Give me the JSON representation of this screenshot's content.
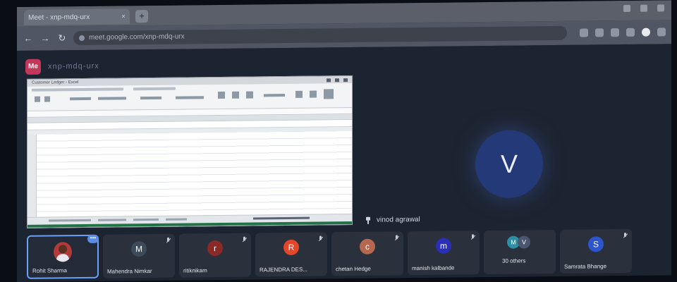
{
  "browser": {
    "tab_label": "Meet - xnp-mdq-urx",
    "url": "meet.google.com/xnp-mdq-urx"
  },
  "meeting": {
    "title": "xnp-mdq-urx",
    "app_badge": "Me"
  },
  "shared_screen": {
    "presenter": "vinod agrawal",
    "window_title": "Customer Ledger - Excel"
  },
  "main_speaker": {
    "initial": "V"
  },
  "participants": [
    {
      "name": "Rohit Sharma",
      "initial": "",
      "color": "#b23a3a",
      "active": true
    },
    {
      "name": "Mahendra Nimkar",
      "initial": "M",
      "color": "#3c4a5a"
    },
    {
      "name": "ritiknikam",
      "initial": "r",
      "color": "#8a2a26"
    },
    {
      "name": "RAJENDRA DES...",
      "initial": "R",
      "color": "#e2462b"
    },
    {
      "name": "chetan Hedge",
      "initial": "c",
      "color": "#b6674f"
    },
    {
      "name": "manish kalbande",
      "initial": "m",
      "color": "#2a2fb5"
    },
    {
      "name": "30 others",
      "initial": "",
      "color": "#3c4a5a"
    },
    {
      "name": "Samrata Bhange",
      "initial": "S",
      "color": "#2d55cc"
    }
  ],
  "others_avatars": [
    {
      "initial": "M",
      "color": "#2c8fa6"
    },
    {
      "initial": "V",
      "color": "#4a5570"
    }
  ],
  "more_label": "•••"
}
